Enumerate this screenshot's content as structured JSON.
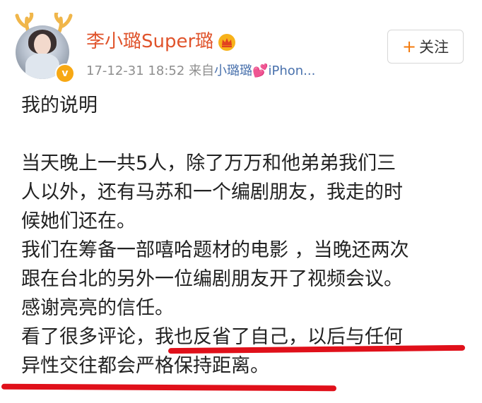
{
  "header": {
    "username": "李小璐Super璐",
    "timestamp": "17-12-31 18:52",
    "source_prefix": "来自",
    "source_name": "小璐璐",
    "source_device": "iPhon...",
    "follow_label": "关注",
    "verified_badge": "v",
    "icons": [
      "crown-icon",
      "heart-icon",
      "plus-icon",
      "antler-decoration",
      "verified-badge-icon"
    ]
  },
  "post": {
    "lines": [
      "我的说明",
      "",
      "当天晚上一共5人，除了万万和他弟弟我们三",
      "人以外，还有马苏和一个编剧朋友，我走的时",
      "候她们还在。",
      "我们在筹备一部嘻哈题材的电影 ，当晚还两次",
      "跟在台北的另外一位编剧朋友开了视频会议。",
      "感谢亮亮的信任。",
      "看了很多评论，我也反省了自己，以后与任何",
      "异性交往都会严格保持距离。"
    ]
  },
  "colors": {
    "username": "#e0542c",
    "meta": "#8e8e8e",
    "source_link": "#4a72ad",
    "follow_plus": "#f4790b",
    "underline": "#e0101a",
    "badge": "#f7a813"
  }
}
